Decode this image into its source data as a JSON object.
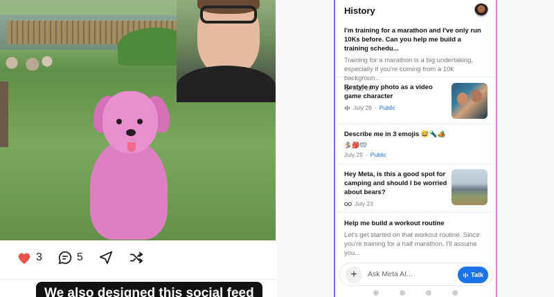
{
  "feed": {
    "likes": "3",
    "comments": "5",
    "caption": "We also designed this social feed"
  },
  "history": {
    "title": "History",
    "items": [
      {
        "title": "I'm training for a marathon and I've only run 10Ks before. Can you help me build a training schedu...",
        "snippet": "Training for a marathon is a big undertaking, especially if you're coming from a 10k backgroun...",
        "date": "July 28",
        "icon": "voice-icon"
      },
      {
        "title": "Restyle my photo as a video game character",
        "date": "July 26",
        "visibility": "Public",
        "icon": "voice-icon"
      },
      {
        "title": "Describe me in 3 emojis 😅🔦🏕️",
        "emojis": "🏂🎒🥽",
        "date": "July 25",
        "visibility": "Public"
      },
      {
        "title": "Hey Meta, is this a good spot for camping and should I be worried about bears?",
        "date": "July 23",
        "icon": "glasses-icon"
      },
      {
        "title": "Help me build a workout routine",
        "snippet": "Let's get started on that workout routine. Since you're training for a half marathon, I'll assume you..."
      }
    ],
    "input_placeholder": "Ask Meta AI...",
    "talk_label": "Talk",
    "separator": " · "
  },
  "colors": {
    "accent": "#1a73e8",
    "like": "#e8534a",
    "border_left": "#7a6af0",
    "border_right": "#e07ed8"
  }
}
